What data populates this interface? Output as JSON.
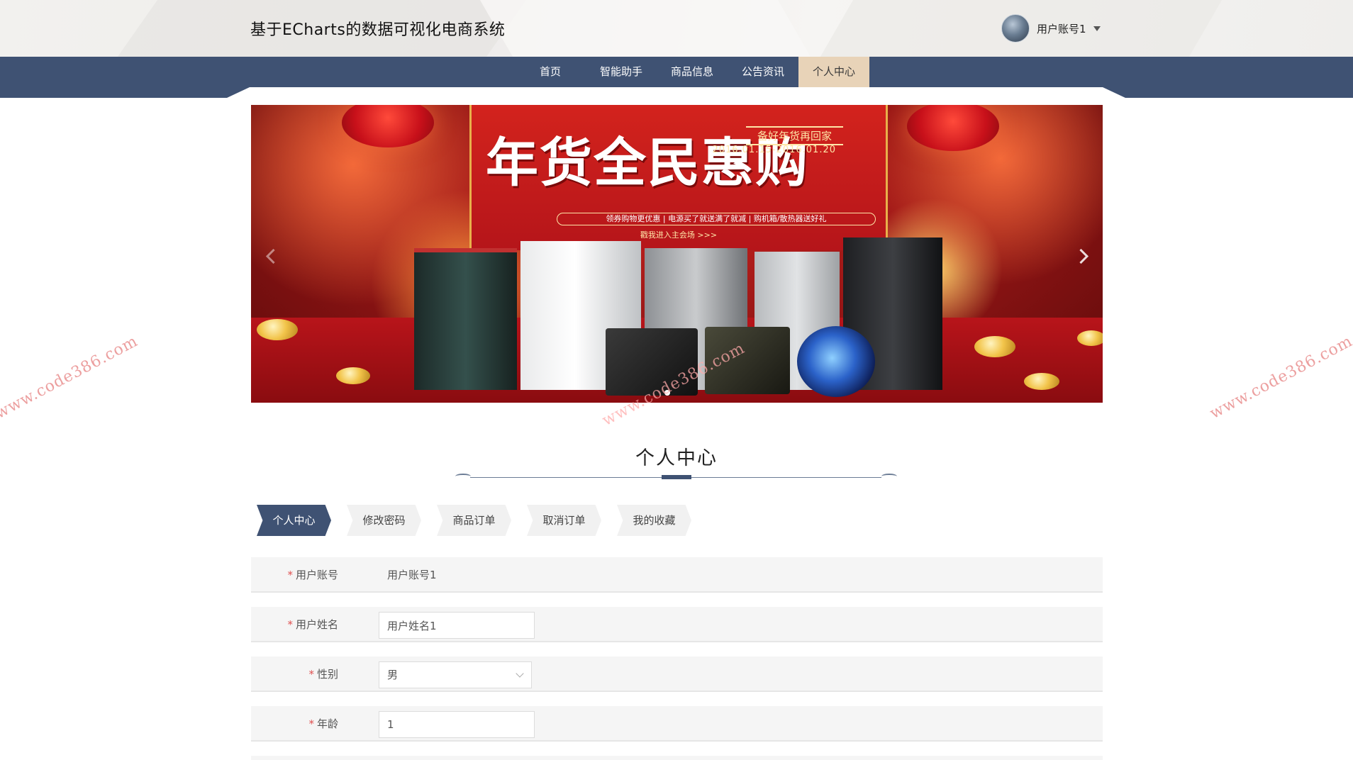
{
  "header": {
    "title": "基于ECharts的数据可视化电商系统",
    "user": {
      "name": "用户账号1",
      "avatar_icon": "user-avatar",
      "dropdown_icon": "caret-down-icon"
    }
  },
  "nav": {
    "items": [
      {
        "label": "首页",
        "active": false
      },
      {
        "label": "智能助手",
        "active": false
      },
      {
        "label": "商品信息",
        "active": false
      },
      {
        "label": "公告资讯",
        "active": false
      },
      {
        "label": "个人中心",
        "active": true
      }
    ],
    "colors": {
      "bar": "#3f5273",
      "active_bg": "#e8d3b8"
    }
  },
  "banner": {
    "headline": "年货全民惠购",
    "tag": "备好年货再回家",
    "date_range": "2016.01.15-2016.01.20",
    "strip": "领券购物更优惠 | 电源买了就送满了就减 | 购机箱/散热器送好礼",
    "sub": "戳我进入主会场 >>>",
    "slide_count": 1,
    "active_slide": 1
  },
  "watermarks": [
    "www.code386.com",
    "www.code386.com",
    "www.code386.com"
  ],
  "section": {
    "title": "个人中心"
  },
  "tabs": [
    {
      "label": "个人中心",
      "active": true
    },
    {
      "label": "修改密码",
      "active": false
    },
    {
      "label": "商品订单",
      "active": false
    },
    {
      "label": "取消订单",
      "active": false
    },
    {
      "label": "我的收藏",
      "active": false
    }
  ],
  "form": {
    "account": {
      "label": "用户账号",
      "value": "用户账号1"
    },
    "name": {
      "label": "用户姓名",
      "value": "用户姓名1"
    },
    "gender": {
      "label": "性别",
      "value": "男"
    },
    "age": {
      "label": "年龄",
      "value": "1"
    }
  }
}
